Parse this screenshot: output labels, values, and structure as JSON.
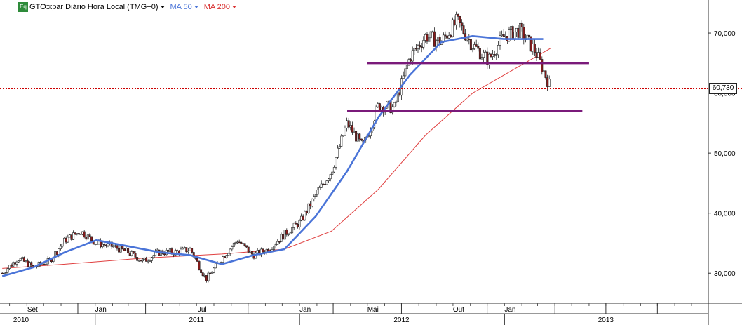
{
  "header": {
    "symbol_icon": "Eq",
    "title": "GTO:xpar Diário Hora Local (TMG+0)",
    "ma50_label": "MA 50",
    "ma200_label": "MA 200"
  },
  "current_price_label": "60,730",
  "colors": {
    "ma50": "#4a74d8",
    "ma200": "#e04040",
    "level_lines": "#7a1a7a",
    "current_price": "#cc0000",
    "candle_up": "#ffffff",
    "candle_down": "#8b1a1a"
  },
  "chart_data": {
    "type": "candlestick",
    "x_axis_type": "date",
    "ylim": [
      25000,
      75500
    ],
    "y_ticks": [
      30000,
      40000,
      50000,
      60000,
      70000
    ],
    "y_tick_labels": [
      "30,000",
      "40,000",
      "50,000",
      "60,000",
      "70,000"
    ],
    "month_ticks": [
      {
        "date": "2010-09",
        "label": "Set"
      },
      {
        "date": "2011-01",
        "label": "Jan"
      },
      {
        "date": "2011-07",
        "label": "Jul"
      },
      {
        "date": "2012-01",
        "label": "Jan"
      },
      {
        "date": "2012-05",
        "label": "Mai"
      },
      {
        "date": "2012-10",
        "label": "Out"
      },
      {
        "date": "2013-01",
        "label": "Jan"
      }
    ],
    "year_labels": [
      "2010",
      "2011",
      "2012",
      "2013"
    ],
    "current_price": 60730,
    "horizontal_levels": [
      {
        "value": 65000,
        "from": "2012-05-01",
        "to": "2013-06-01"
      },
      {
        "value": 57000,
        "from": "2012-03-26",
        "to": "2013-05-20"
      }
    ],
    "series": [
      {
        "name": "GTO:xpar",
        "type": "candlestick",
        "dates": [
          "2010-07-19",
          "2010-08-16",
          "2010-09-13",
          "2010-10-11",
          "2010-11-08",
          "2010-12-06",
          "2011-01-03",
          "2011-01-31",
          "2011-02-28",
          "2011-03-28",
          "2011-04-25",
          "2011-05-23",
          "2011-06-20",
          "2011-07-18",
          "2011-08-15",
          "2011-09-12",
          "2011-10-10",
          "2011-11-07",
          "2011-12-05",
          "2012-01-02",
          "2012-01-30",
          "2012-02-27",
          "2012-03-26",
          "2012-04-23",
          "2012-05-21",
          "2012-06-18",
          "2012-07-16",
          "2012-08-13",
          "2012-09-10",
          "2012-10-08",
          "2012-11-05",
          "2012-12-03",
          "2012-12-31",
          "2013-01-28",
          "2013-02-25",
          "2013-03-25"
        ],
        "close": [
          30000,
          32500,
          31000,
          32000,
          35500,
          37000,
          35000,
          34500,
          33500,
          32000,
          33500,
          33500,
          34000,
          29000,
          32500,
          35500,
          33000,
          34000,
          36500,
          38500,
          43000,
          47000,
          55000,
          51000,
          58000,
          57500,
          66000,
          69500,
          68500,
          72000,
          68000,
          65500,
          69500,
          70500,
          67000,
          60730
        ]
      },
      {
        "name": "MA 50",
        "dates": [
          "2010-07-19",
          "2010-09-13",
          "2010-11-08",
          "2011-01-03",
          "2011-02-28",
          "2011-04-25",
          "2011-06-20",
          "2011-08-15",
          "2011-10-10",
          "2011-12-05",
          "2012-01-30",
          "2012-03-26",
          "2012-05-21",
          "2012-07-16",
          "2012-09-10",
          "2012-11-05",
          "2012-12-31",
          "2013-02-25",
          "2013-03-11"
        ],
        "values": [
          29500,
          31000,
          33500,
          35500,
          34500,
          33500,
          33000,
          31500,
          33000,
          34000,
          39500,
          47000,
          56000,
          63000,
          68500,
          69500,
          69000,
          69000,
          69000
        ]
      },
      {
        "name": "MA 200",
        "dates": [
          "2010-07-19",
          "2010-11-08",
          "2011-03-28",
          "2011-08-15",
          "2011-12-05",
          "2012-02-27",
          "2012-05-21",
          "2012-08-13",
          "2012-11-05",
          "2013-01-28",
          "2013-03-25"
        ],
        "values": [
          30800,
          31500,
          32500,
          33200,
          34000,
          37000,
          44000,
          53000,
          60000,
          64500,
          67500
        ]
      }
    ]
  }
}
